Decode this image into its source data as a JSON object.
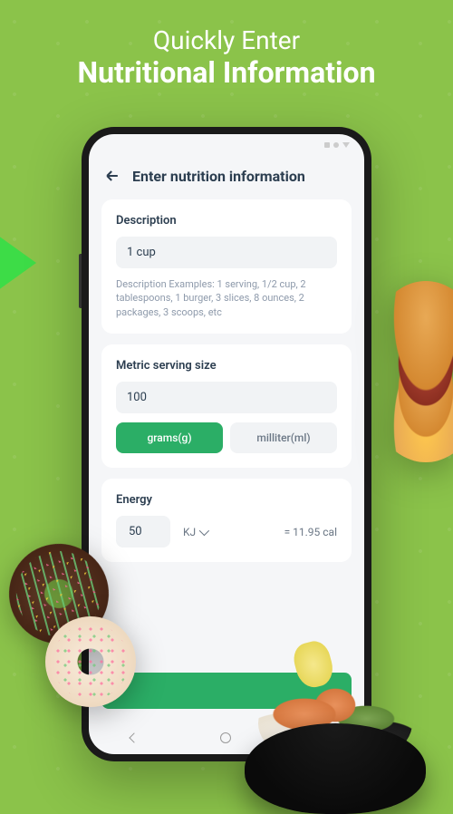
{
  "promo": {
    "line1": "Quickly Enter",
    "line2": "Nutritional Information"
  },
  "header": {
    "title": "Enter nutrition information"
  },
  "description": {
    "label": "Description",
    "value": "1 cup",
    "hint": "Description Examples: 1 serving, 1/2 cup, 2 tablespoons, 1 burger, 3 slices, 8 ounces, 2 packages, 3 scoops, etc"
  },
  "metric": {
    "label": "Metric serving size",
    "value": "100",
    "unit_grams": "grams(g)",
    "unit_ml": "milliter(ml)"
  },
  "energy": {
    "label": "Energy",
    "value": "50",
    "unit": "KJ",
    "result": "= 11.95 cal"
  }
}
